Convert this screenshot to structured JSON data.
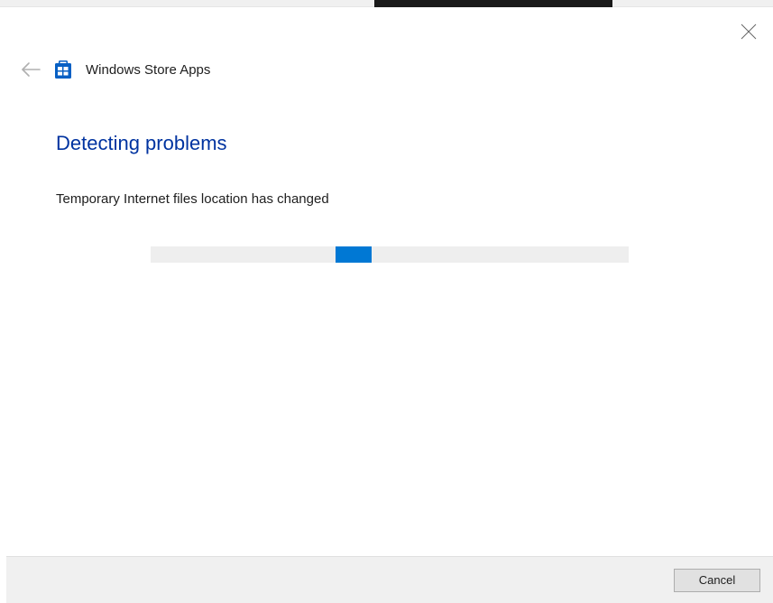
{
  "header": {
    "app_title": "Windows Store Apps"
  },
  "content": {
    "heading": "Detecting problems",
    "status_text": "Temporary Internet files location has changed"
  },
  "footer": {
    "cancel_label": "Cancel"
  },
  "colors": {
    "accent_blue": "#0078d4",
    "heading_blue": "#0033a0"
  }
}
